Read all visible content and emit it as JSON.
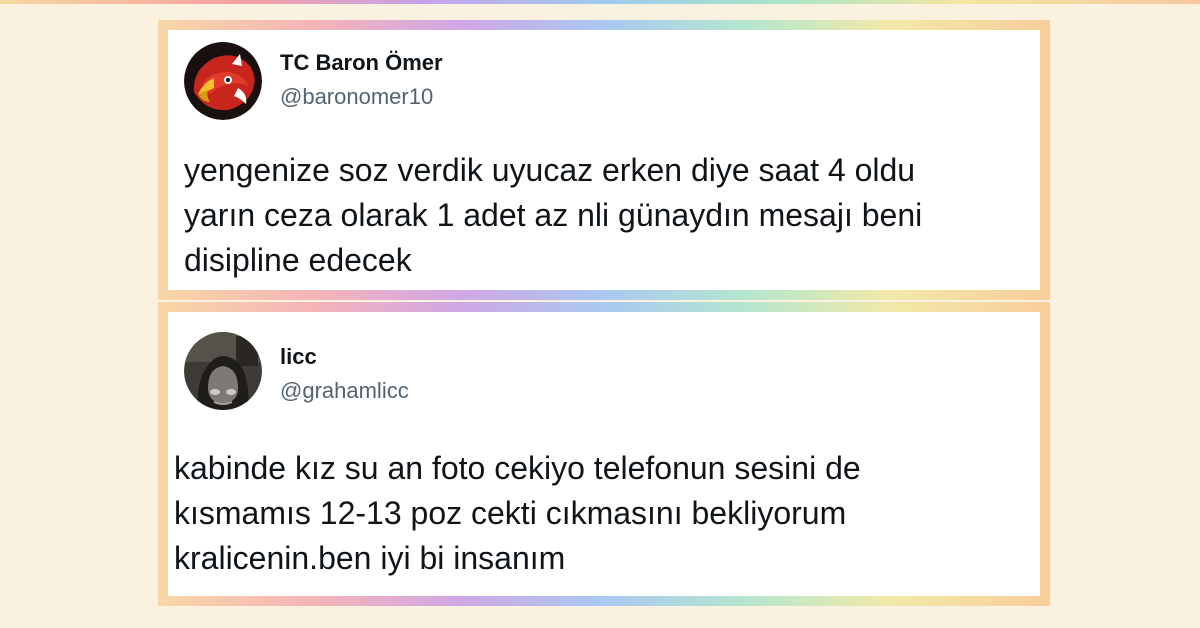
{
  "tweets": [
    {
      "name": "TC Baron Ömer",
      "handle": "@baronomer10",
      "avatar_icon": "eagle-avatar-icon",
      "text_lines": [
        "yengenize soz verdik uyucaz erken diye saat 4 oldu",
        "yarın ceza olarak 1 adet az nli günaydın mesajı beni",
        "disipline edecek"
      ]
    },
    {
      "name": "licc",
      "handle": "@grahamlicc",
      "avatar_icon": "selfie-avatar-icon",
      "text_lines": [
        "kabinde kız su an foto cekiyo telefonun sesini de",
        "kısmamıs 12-13 poz cekti cıkmasını bekliyorum",
        "kralicenin.ben iyi bi insanım"
      ]
    }
  ],
  "colors": {
    "background": "#fbf1e0",
    "text": "#0f1419",
    "handle": "#536471"
  }
}
